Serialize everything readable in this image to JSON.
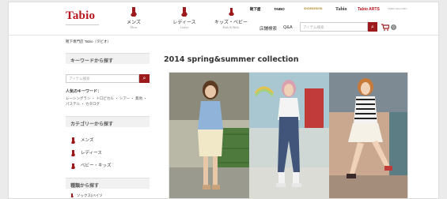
{
  "header": {
    "logo": "Tabio",
    "nav": [
      {
        "label": "メンズ",
        "sub": "Mens"
      },
      {
        "label": "レディース",
        "sub": "Ladies"
      },
      {
        "label": "キッズ・ベビー",
        "sub": "Kids & Baby"
      }
    ],
    "brands": [
      "靴下屋",
      "TABIO",
      "SHOEDESIGN",
      "Tabio",
      "Tabio ARTS",
      "TABIO LEG LABO"
    ],
    "store_search": "店舗検索",
    "qa": "Q&A",
    "search_placeholder": "アイテム検索",
    "search_icon": "magnifier-icon",
    "cart_count": "0"
  },
  "breadcrumb": "靴下専門店 Tabio（タビオ）",
  "sidebar": {
    "keyword_title": "キーワードから探す",
    "search_placeholder": "アイテム検索",
    "popular_title": "人気のキーワード：",
    "popular_keywords": "レーシングラン ・ トロピカル ・ シアー ・ 無地 ・ パステル ・ カタログ",
    "category_title": "カテゴリーから探す",
    "categories": [
      "メンズ",
      "レディース",
      "ベビー・キッズ"
    ],
    "type_title": "種類から探す",
    "types_first": "ソックス(ハイソ"
  },
  "main": {
    "title": "2014 spring&summer collection"
  },
  "colors": {
    "brand_red": "#b8141d",
    "button_red": "#9c1a1c"
  }
}
